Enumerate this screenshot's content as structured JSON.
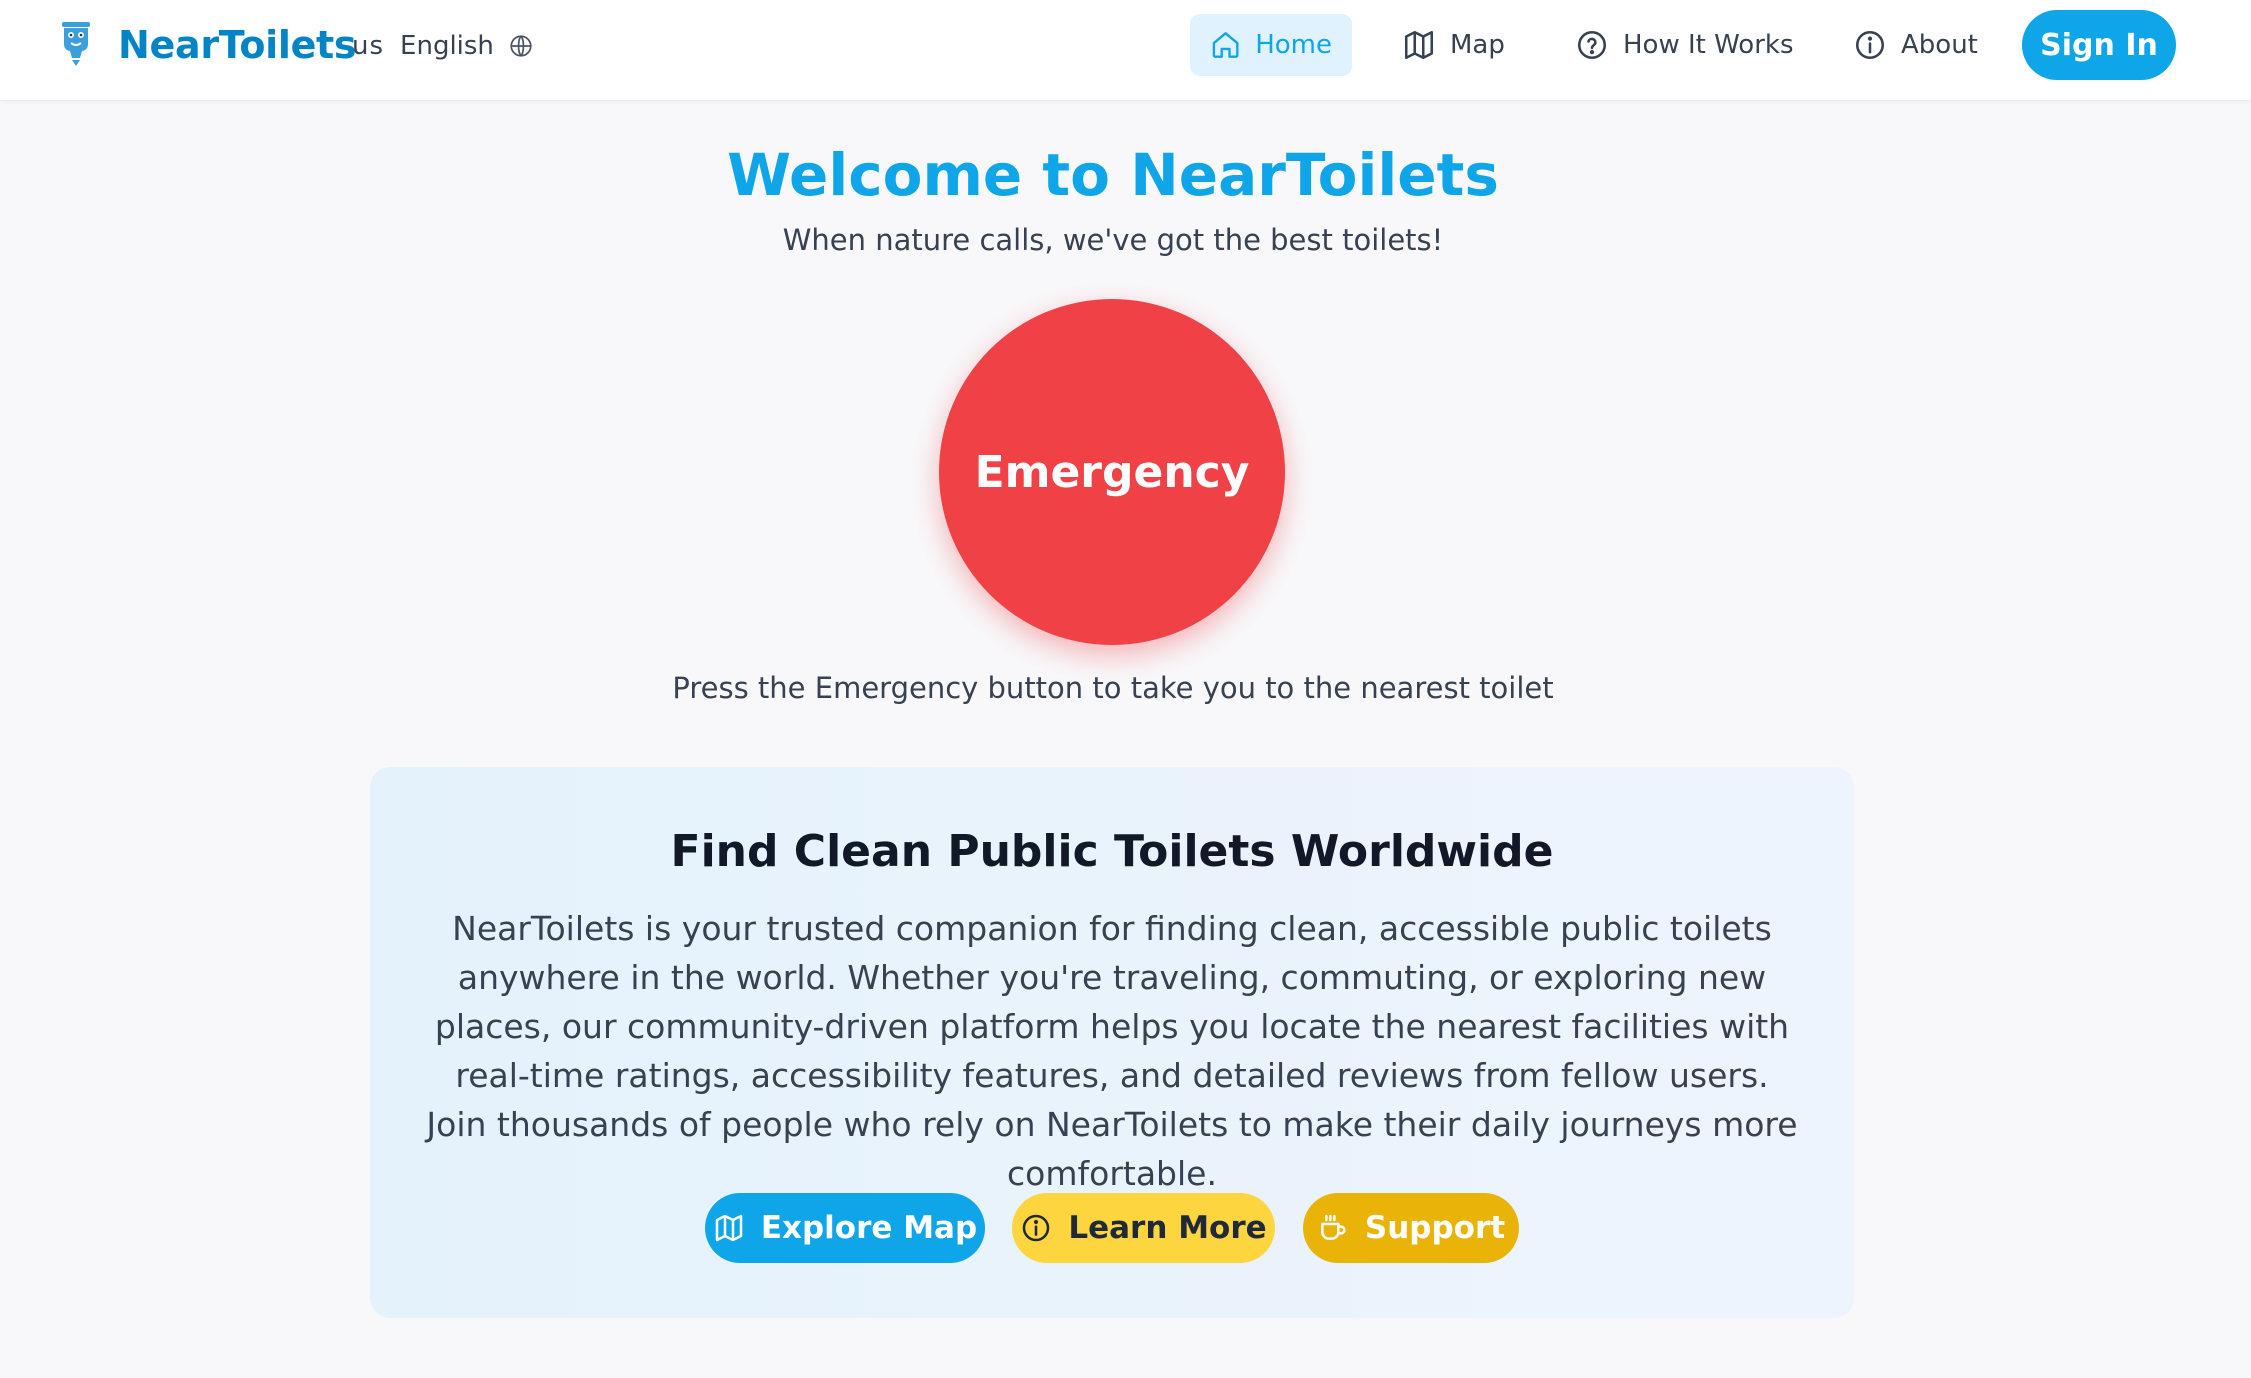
{
  "navbar": {
    "brand": "NearToilets",
    "language": {
      "flag": "us",
      "label": "English"
    },
    "items": [
      {
        "label": "Home",
        "icon": "home-icon",
        "active": true
      },
      {
        "label": "Map",
        "icon": "map-icon",
        "active": false
      },
      {
        "label": "How It Works",
        "icon": "help-circle-icon",
        "active": false
      },
      {
        "label": "About",
        "icon": "info-icon",
        "active": false
      }
    ],
    "signin_label": "Sign In"
  },
  "hero": {
    "title": "Welcome to NearToilets",
    "subtitle": "When nature calls, we've got the best toilets!",
    "emergency_label": "Emergency",
    "emergency_hint": "Press the Emergency button to take you to the nearest toilet"
  },
  "info_card": {
    "title": "Find Clean Public Toilets Worldwide",
    "body": "NearToilets is your trusted companion for finding clean, accessible public toilets anywhere in the world. Whether you're traveling, commuting, or exploring new places, our community-driven platform helps you locate the nearest facilities with real-time ratings, accessibility features, and detailed reviews from fellow users. Join thousands of people who rely on NearToilets to make their daily journeys more comfortable.",
    "buttons": [
      {
        "label": "Explore Map",
        "icon": "map-icon"
      },
      {
        "label": "Learn More",
        "icon": "info-icon"
      },
      {
        "label": "Support",
        "icon": "coffee-icon"
      }
    ]
  },
  "colors": {
    "primary": "#0ea5e9",
    "brand": "#0284c7",
    "emergency": "#ef4146",
    "learn_more": "#fcd53f",
    "support": "#eab308",
    "active_nav_bg": "#e0f2fe"
  }
}
